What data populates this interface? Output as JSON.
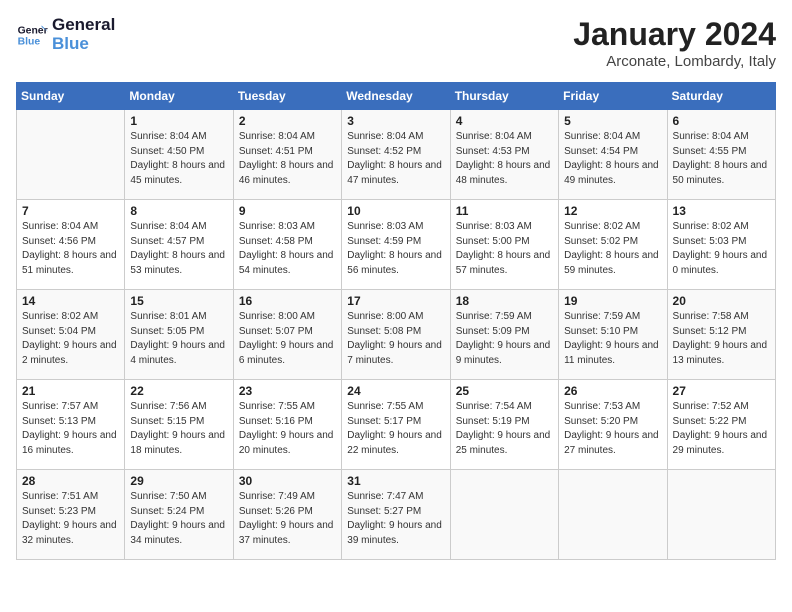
{
  "header": {
    "logo_line1": "General",
    "logo_line2": "Blue",
    "month": "January 2024",
    "location": "Arconate, Lombardy, Italy"
  },
  "weekdays": [
    "Sunday",
    "Monday",
    "Tuesday",
    "Wednesday",
    "Thursday",
    "Friday",
    "Saturday"
  ],
  "weeks": [
    [
      {
        "day": "",
        "sunrise": "",
        "sunset": "",
        "daylight": ""
      },
      {
        "day": "1",
        "sunrise": "Sunrise: 8:04 AM",
        "sunset": "Sunset: 4:50 PM",
        "daylight": "Daylight: 8 hours and 45 minutes."
      },
      {
        "day": "2",
        "sunrise": "Sunrise: 8:04 AM",
        "sunset": "Sunset: 4:51 PM",
        "daylight": "Daylight: 8 hours and 46 minutes."
      },
      {
        "day": "3",
        "sunrise": "Sunrise: 8:04 AM",
        "sunset": "Sunset: 4:52 PM",
        "daylight": "Daylight: 8 hours and 47 minutes."
      },
      {
        "day": "4",
        "sunrise": "Sunrise: 8:04 AM",
        "sunset": "Sunset: 4:53 PM",
        "daylight": "Daylight: 8 hours and 48 minutes."
      },
      {
        "day": "5",
        "sunrise": "Sunrise: 8:04 AM",
        "sunset": "Sunset: 4:54 PM",
        "daylight": "Daylight: 8 hours and 49 minutes."
      },
      {
        "day": "6",
        "sunrise": "Sunrise: 8:04 AM",
        "sunset": "Sunset: 4:55 PM",
        "daylight": "Daylight: 8 hours and 50 minutes."
      }
    ],
    [
      {
        "day": "7",
        "sunrise": "Sunrise: 8:04 AM",
        "sunset": "Sunset: 4:56 PM",
        "daylight": "Daylight: 8 hours and 51 minutes."
      },
      {
        "day": "8",
        "sunrise": "Sunrise: 8:04 AM",
        "sunset": "Sunset: 4:57 PM",
        "daylight": "Daylight: 8 hours and 53 minutes."
      },
      {
        "day": "9",
        "sunrise": "Sunrise: 8:03 AM",
        "sunset": "Sunset: 4:58 PM",
        "daylight": "Daylight: 8 hours and 54 minutes."
      },
      {
        "day": "10",
        "sunrise": "Sunrise: 8:03 AM",
        "sunset": "Sunset: 4:59 PM",
        "daylight": "Daylight: 8 hours and 56 minutes."
      },
      {
        "day": "11",
        "sunrise": "Sunrise: 8:03 AM",
        "sunset": "Sunset: 5:00 PM",
        "daylight": "Daylight: 8 hours and 57 minutes."
      },
      {
        "day": "12",
        "sunrise": "Sunrise: 8:02 AM",
        "sunset": "Sunset: 5:02 PM",
        "daylight": "Daylight: 8 hours and 59 minutes."
      },
      {
        "day": "13",
        "sunrise": "Sunrise: 8:02 AM",
        "sunset": "Sunset: 5:03 PM",
        "daylight": "Daylight: 9 hours and 0 minutes."
      }
    ],
    [
      {
        "day": "14",
        "sunrise": "Sunrise: 8:02 AM",
        "sunset": "Sunset: 5:04 PM",
        "daylight": "Daylight: 9 hours and 2 minutes."
      },
      {
        "day": "15",
        "sunrise": "Sunrise: 8:01 AM",
        "sunset": "Sunset: 5:05 PM",
        "daylight": "Daylight: 9 hours and 4 minutes."
      },
      {
        "day": "16",
        "sunrise": "Sunrise: 8:00 AM",
        "sunset": "Sunset: 5:07 PM",
        "daylight": "Daylight: 9 hours and 6 minutes."
      },
      {
        "day": "17",
        "sunrise": "Sunrise: 8:00 AM",
        "sunset": "Sunset: 5:08 PM",
        "daylight": "Daylight: 9 hours and 7 minutes."
      },
      {
        "day": "18",
        "sunrise": "Sunrise: 7:59 AM",
        "sunset": "Sunset: 5:09 PM",
        "daylight": "Daylight: 9 hours and 9 minutes."
      },
      {
        "day": "19",
        "sunrise": "Sunrise: 7:59 AM",
        "sunset": "Sunset: 5:10 PM",
        "daylight": "Daylight: 9 hours and 11 minutes."
      },
      {
        "day": "20",
        "sunrise": "Sunrise: 7:58 AM",
        "sunset": "Sunset: 5:12 PM",
        "daylight": "Daylight: 9 hours and 13 minutes."
      }
    ],
    [
      {
        "day": "21",
        "sunrise": "Sunrise: 7:57 AM",
        "sunset": "Sunset: 5:13 PM",
        "daylight": "Daylight: 9 hours and 16 minutes."
      },
      {
        "day": "22",
        "sunrise": "Sunrise: 7:56 AM",
        "sunset": "Sunset: 5:15 PM",
        "daylight": "Daylight: 9 hours and 18 minutes."
      },
      {
        "day": "23",
        "sunrise": "Sunrise: 7:55 AM",
        "sunset": "Sunset: 5:16 PM",
        "daylight": "Daylight: 9 hours and 20 minutes."
      },
      {
        "day": "24",
        "sunrise": "Sunrise: 7:55 AM",
        "sunset": "Sunset: 5:17 PM",
        "daylight": "Daylight: 9 hours and 22 minutes."
      },
      {
        "day": "25",
        "sunrise": "Sunrise: 7:54 AM",
        "sunset": "Sunset: 5:19 PM",
        "daylight": "Daylight: 9 hours and 25 minutes."
      },
      {
        "day": "26",
        "sunrise": "Sunrise: 7:53 AM",
        "sunset": "Sunset: 5:20 PM",
        "daylight": "Daylight: 9 hours and 27 minutes."
      },
      {
        "day": "27",
        "sunrise": "Sunrise: 7:52 AM",
        "sunset": "Sunset: 5:22 PM",
        "daylight": "Daylight: 9 hours and 29 minutes."
      }
    ],
    [
      {
        "day": "28",
        "sunrise": "Sunrise: 7:51 AM",
        "sunset": "Sunset: 5:23 PM",
        "daylight": "Daylight: 9 hours and 32 minutes."
      },
      {
        "day": "29",
        "sunrise": "Sunrise: 7:50 AM",
        "sunset": "Sunset: 5:24 PM",
        "daylight": "Daylight: 9 hours and 34 minutes."
      },
      {
        "day": "30",
        "sunrise": "Sunrise: 7:49 AM",
        "sunset": "Sunset: 5:26 PM",
        "daylight": "Daylight: 9 hours and 37 minutes."
      },
      {
        "day": "31",
        "sunrise": "Sunrise: 7:47 AM",
        "sunset": "Sunset: 5:27 PM",
        "daylight": "Daylight: 9 hours and 39 minutes."
      },
      {
        "day": "",
        "sunrise": "",
        "sunset": "",
        "daylight": ""
      },
      {
        "day": "",
        "sunrise": "",
        "sunset": "",
        "daylight": ""
      },
      {
        "day": "",
        "sunrise": "",
        "sunset": "",
        "daylight": ""
      }
    ]
  ]
}
